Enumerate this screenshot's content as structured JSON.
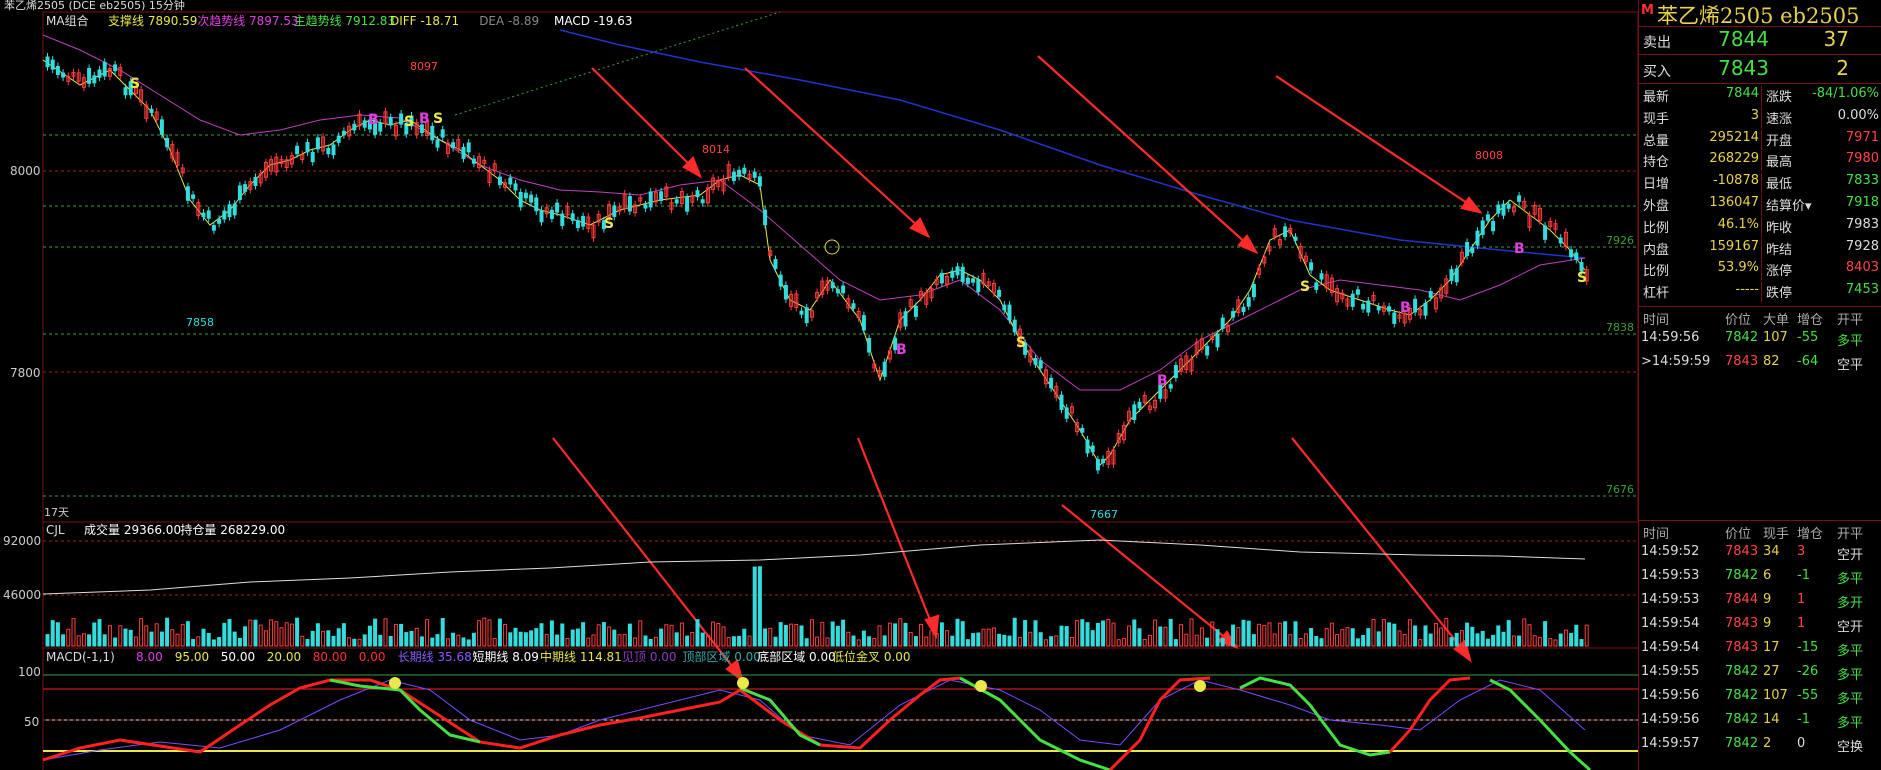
{
  "top_bar": {
    "title": "苯乙烯2505 (DCE eb2505)  15分钟"
  },
  "ma_indicator": {
    "label": "MA组合",
    "items": [
      {
        "text": "支撑线 7890.59",
        "color": "#e8e84a"
      },
      {
        "text": "次趋势线 7897.53",
        "color": "#e040e0"
      },
      {
        "text": "主趋势线 7912.83",
        "color": "#44e044"
      },
      {
        "text": "DIFF -18.71",
        "color": "#e8e84a"
      },
      {
        "text": "DEA -8.89",
        "color": "#888888"
      },
      {
        "text": "MACD -19.63",
        "color": "#ffffff"
      }
    ]
  },
  "price_axis": {
    "labels": [
      "8000",
      "7800"
    ]
  },
  "price_marks": {
    "high1": "8097",
    "high2": "8014",
    "high3": "8008",
    "low1": "7858",
    "low2": "7667",
    "level_7926": "7926",
    "level_7838": "7838",
    "level_7676": "7676",
    "days": "17天"
  },
  "volume_indicator": {
    "label": "CJL",
    "items": [
      {
        "text": "成交量 29366.00",
        "color": "#ffffff"
      },
      {
        "text": "持仓量 268229.00",
        "color": "#ffffff"
      }
    ],
    "axis": [
      "92000",
      "46000"
    ]
  },
  "macd_indicator": {
    "label": "MACD(-1,1)",
    "items": [
      {
        "text": "8.00",
        "color": "#e040e0"
      },
      {
        "text": "95.00",
        "color": "#e8e84a"
      },
      {
        "text": "50.00",
        "color": "#ffffff"
      },
      {
        "text": "20.00",
        "color": "#e8e84a"
      },
      {
        "text": "80.00",
        "color": "#ff3030"
      },
      {
        "text": "0.00",
        "color": "#ff3030"
      },
      {
        "text": "长期线 35.68",
        "color": "#8a5cff"
      },
      {
        "text": "短期线 8.09",
        "color": "#ffffff"
      },
      {
        "text": "中期线 114.81",
        "color": "#e8e84a"
      },
      {
        "text": "见顶 0.00",
        "color": "#8a3cc0"
      },
      {
        "text": "顶部区域 0.00",
        "color": "#33aaaa"
      },
      {
        "text": "底部区域 0.00",
        "color": "#ffffff"
      },
      {
        "text": "低位金叉 0.00",
        "color": "#e8e84a"
      }
    ],
    "axis": [
      "100",
      "50"
    ]
  },
  "panel": {
    "badge": "M",
    "title": "苯乙烯2505 eb2505",
    "sell": {
      "label": "卖出",
      "price": "7844",
      "vol": "37"
    },
    "buy": {
      "label": "买入",
      "price": "7843",
      "vol": "2"
    },
    "quote": [
      {
        "l": "最新",
        "v": "7844",
        "vc": "#44e044",
        "l2": "涨跌",
        "v2": "-84/1.06%",
        "v2c": "#44e044"
      },
      {
        "l": "现手",
        "v": "3",
        "vc": "#e8d24a",
        "l2": "速涨",
        "v2": "0.00%",
        "v2c": "#dddddd"
      },
      {
        "l": "总量",
        "v": "295214",
        "vc": "#e8d24a",
        "l2": "开盘",
        "v2": "7971",
        "v2c": "#ff4444"
      },
      {
        "l": "持仓",
        "v": "268229",
        "vc": "#e8d24a",
        "l2": "最高",
        "v2": "7980",
        "v2c": "#ff4444"
      },
      {
        "l": "日增",
        "v": "-10878",
        "vc": "#e8d24a",
        "l2": "最低",
        "v2": "7833",
        "v2c": "#44e044"
      },
      {
        "l": "外盘",
        "v": "136047",
        "vc": "#e8d24a",
        "l2": "结算价▾",
        "v2": "7918",
        "v2c": "#44e044"
      },
      {
        "l": "比例",
        "v": "46.1%",
        "vc": "#e8d24a",
        "l2": "昨收",
        "v2": "7983",
        "v2c": "#dddddd"
      },
      {
        "l": "内盘",
        "v": "159167",
        "vc": "#e8d24a",
        "l2": "昨结",
        "v2": "7928",
        "v2c": "#dddddd"
      },
      {
        "l": "比例",
        "v": "53.9%",
        "vc": "#e8d24a",
        "l2": "涨停",
        "v2": "8403",
        "v2c": "#ff4444"
      },
      {
        "l": "杠杆",
        "v": "-----",
        "vc": "#e8d24a",
        "l2": "跌停",
        "v2": "7453",
        "v2c": "#44e044"
      }
    ],
    "tick_headers1": [
      "时间",
      "价位",
      "大单",
      "增仓",
      "开平"
    ],
    "big_trades": [
      {
        "time": "14:59:56",
        "price": "7842",
        "vol": "107",
        "inc": "-55",
        "type": "多平"
      },
      {
        "time": ">14:59:59",
        "price": "7843",
        "vol": "82",
        "inc": "-64",
        "type": "空平"
      }
    ],
    "tick_headers2": [
      "时间",
      "价位",
      "现手",
      "增仓",
      "开平"
    ],
    "ticks": [
      {
        "time": "14:59:52",
        "price": "7843",
        "vol": "34",
        "inc": "3",
        "type": "空开"
      },
      {
        "time": "14:59:53",
        "price": "7842",
        "vol": "6",
        "inc": "-1",
        "type": "多平"
      },
      {
        "time": "14:59:53",
        "price": "7844",
        "vol": "9",
        "inc": "1",
        "type": "多开"
      },
      {
        "time": "14:59:54",
        "price": "7843",
        "vol": "9",
        "inc": "1",
        "type": "空开"
      },
      {
        "time": "14:59:54",
        "price": "7843",
        "vol": "17",
        "inc": "-15",
        "type": "多平"
      },
      {
        "time": "14:59:55",
        "price": "7842",
        "vol": "27",
        "inc": "-26",
        "type": "多平"
      },
      {
        "time": "14:59:56",
        "price": "7842",
        "vol": "107",
        "inc": "-55",
        "type": "多平"
      },
      {
        "time": "14:59:56",
        "price": "7842",
        "vol": "14",
        "inc": "-1",
        "type": "多平"
      },
      {
        "time": "14:59:57",
        "price": "7842",
        "vol": "2",
        "inc": "0",
        "type": "空换"
      }
    ]
  }
}
